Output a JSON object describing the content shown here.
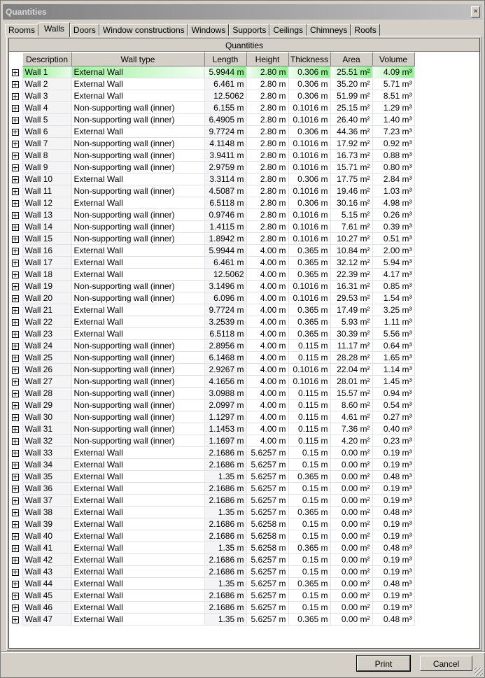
{
  "window": {
    "title": "Quantities",
    "close_label": "×"
  },
  "tabs": [
    {
      "label": "Rooms",
      "active": false
    },
    {
      "label": "Walls",
      "active": true
    },
    {
      "label": "Doors",
      "active": false
    },
    {
      "label": "Window constructions",
      "active": false
    },
    {
      "label": "Windows",
      "active": false
    },
    {
      "label": "Supports",
      "active": false
    },
    {
      "label": "Ceilings",
      "active": false
    },
    {
      "label": "Chimneys",
      "active": false
    },
    {
      "label": "Roofs",
      "active": false
    }
  ],
  "grid": {
    "group_header": "Quantities",
    "columns": [
      "Description",
      "Wall type",
      "Length",
      "Height",
      "Thickness",
      "Area",
      "Volume"
    ],
    "selected_row": 0,
    "rows": [
      [
        "Wall 1",
        "External Wall",
        "5.9944 m",
        "2.80 m",
        "0.306 m",
        "25.51 m²",
        "4.09 m³"
      ],
      [
        "Wall 2",
        "External Wall",
        "6.461 m",
        "2.80 m",
        "0.306 m",
        "35.20 m²",
        "5.71 m³"
      ],
      [
        "Wall 3",
        "External Wall",
        "12.5062",
        "2.80 m",
        "0.306 m",
        "51.99 m²",
        "8.51 m³"
      ],
      [
        "Wall 4",
        "Non-supporting wall (inner)",
        "6.155 m",
        "2.80 m",
        "0.1016 m",
        "25.15 m²",
        "1.29 m³"
      ],
      [
        "Wall 5",
        "Non-supporting wall (inner)",
        "6.4905 m",
        "2.80 m",
        "0.1016 m",
        "26.40 m²",
        "1.40 m³"
      ],
      [
        "Wall 6",
        "External Wall",
        "9.7724 m",
        "2.80 m",
        "0.306 m",
        "44.36 m²",
        "7.23 m³"
      ],
      [
        "Wall 7",
        "Non-supporting wall (inner)",
        "4.1148 m",
        "2.80 m",
        "0.1016 m",
        "17.92 m²",
        "0.92 m³"
      ],
      [
        "Wall 8",
        "Non-supporting wall (inner)",
        "3.9411 m",
        "2.80 m",
        "0.1016 m",
        "16.73 m²",
        "0.88 m³"
      ],
      [
        "Wall 9",
        "Non-supporting wall (inner)",
        "2.9759 m",
        "2.80 m",
        "0.1016 m",
        "15.71 m²",
        "0.80 m³"
      ],
      [
        "Wall 10",
        "External Wall",
        "3.3114 m",
        "2.80 m",
        "0.306 m",
        "17.75 m²",
        "2.84 m³"
      ],
      [
        "Wall 11",
        "Non-supporting wall (inner)",
        "4.5087 m",
        "2.80 m",
        "0.1016 m",
        "19.46 m²",
        "1.03 m³"
      ],
      [
        "Wall 12",
        "External Wall",
        "6.5118 m",
        "2.80 m",
        "0.306 m",
        "30.16 m²",
        "4.98 m³"
      ],
      [
        "Wall 13",
        "Non-supporting wall (inner)",
        "0.9746 m",
        "2.80 m",
        "0.1016 m",
        "5.15 m²",
        "0.26 m³"
      ],
      [
        "Wall 14",
        "Non-supporting wall (inner)",
        "1.4115 m",
        "2.80 m",
        "0.1016 m",
        "7.61 m²",
        "0.39 m³"
      ],
      [
        "Wall 15",
        "Non-supporting wall (inner)",
        "1.8942 m",
        "2.80 m",
        "0.1016 m",
        "10.27 m²",
        "0.51 m³"
      ],
      [
        "Wall 16",
        "External Wall",
        "5.9944 m",
        "4.00 m",
        "0.365 m",
        "10.84 m²",
        "2.00 m³"
      ],
      [
        "Wall 17",
        "External Wall",
        "6.461 m",
        "4.00 m",
        "0.365 m",
        "32.12 m²",
        "5.94 m³"
      ],
      [
        "Wall 18",
        "External Wall",
        "12.5062",
        "4.00 m",
        "0.365 m",
        "22.39 m²",
        "4.17 m³"
      ],
      [
        "Wall 19",
        "Non-supporting wall (inner)",
        "3.1496 m",
        "4.00 m",
        "0.1016 m",
        "16.31 m²",
        "0.85 m³"
      ],
      [
        "Wall 20",
        "Non-supporting wall (inner)",
        "6.096 m",
        "4.00 m",
        "0.1016 m",
        "29.53 m²",
        "1.54 m³"
      ],
      [
        "Wall 21",
        "External Wall",
        "9.7724 m",
        "4.00 m",
        "0.365 m",
        "17.49 m²",
        "3.25 m³"
      ],
      [
        "Wall 22",
        "External Wall",
        "3.2539 m",
        "4.00 m",
        "0.365 m",
        "5.93 m²",
        "1.11 m³"
      ],
      [
        "Wall 23",
        "External Wall",
        "6.5118 m",
        "4.00 m",
        "0.365 m",
        "30.39 m²",
        "5.56 m³"
      ],
      [
        "Wall 24",
        "Non-supporting wall (inner)",
        "2.8956 m",
        "4.00 m",
        "0.115 m",
        "11.17 m²",
        "0.64 m³"
      ],
      [
        "Wall 25",
        "Non-supporting wall (inner)",
        "6.1468 m",
        "4.00 m",
        "0.115 m",
        "28.28 m²",
        "1.65 m³"
      ],
      [
        "Wall 26",
        "Non-supporting wall (inner)",
        "2.9267 m",
        "4.00 m",
        "0.1016 m",
        "22.04 m²",
        "1.14 m³"
      ],
      [
        "Wall 27",
        "Non-supporting wall (inner)",
        "4.1656 m",
        "4.00 m",
        "0.1016 m",
        "28.01 m²",
        "1.45 m³"
      ],
      [
        "Wall 28",
        "Non-supporting wall (inner)",
        "3.0988 m",
        "4.00 m",
        "0.115 m",
        "15.57 m²",
        "0.94 m³"
      ],
      [
        "Wall 29",
        "Non-supporting wall (inner)",
        "2.0997 m",
        "4.00 m",
        "0.115 m",
        "8.60 m²",
        "0.54 m³"
      ],
      [
        "Wall 30",
        "Non-supporting wall (inner)",
        "1.1297 m",
        "4.00 m",
        "0.115 m",
        "4.61 m²",
        "0.27 m³"
      ],
      [
        "Wall 31",
        "Non-supporting wall (inner)",
        "1.1453 m",
        "4.00 m",
        "0.115 m",
        "7.36 m²",
        "0.40 m³"
      ],
      [
        "Wall 32",
        "Non-supporting wall (inner)",
        "1.1697 m",
        "4.00 m",
        "0.115 m",
        "4.20 m²",
        "0.23 m³"
      ],
      [
        "Wall 33",
        "External Wall",
        "2.1686 m",
        "5.6257 m",
        "0.15 m",
        "0.00 m²",
        "0.19 m³"
      ],
      [
        "Wall 34",
        "External Wall",
        "2.1686 m",
        "5.6257 m",
        "0.15 m",
        "0.00 m²",
        "0.19 m³"
      ],
      [
        "Wall 35",
        "External Wall",
        "1.35 m",
        "5.6257 m",
        "0.365 m",
        "0.00 m²",
        "0.48 m³"
      ],
      [
        "Wall 36",
        "External Wall",
        "2.1686 m",
        "5.6257 m",
        "0.15 m",
        "0.00 m²",
        "0.19 m³"
      ],
      [
        "Wall 37",
        "External Wall",
        "2.1686 m",
        "5.6257 m",
        "0.15 m",
        "0.00 m²",
        "0.19 m³"
      ],
      [
        "Wall 38",
        "External Wall",
        "1.35 m",
        "5.6257 m",
        "0.365 m",
        "0.00 m²",
        "0.48 m³"
      ],
      [
        "Wall 39",
        "External Wall",
        "2.1686 m",
        "5.6258 m",
        "0.15 m",
        "0.00 m²",
        "0.19 m³"
      ],
      [
        "Wall 40",
        "External Wall",
        "2.1686 m",
        "5.6258 m",
        "0.15 m",
        "0.00 m²",
        "0.19 m³"
      ],
      [
        "Wall 41",
        "External Wall",
        "1.35 m",
        "5.6258 m",
        "0.365 m",
        "0.00 m²",
        "0.48 m³"
      ],
      [
        "Wall 42",
        "External Wall",
        "2.1686 m",
        "5.6257 m",
        "0.15 m",
        "0.00 m²",
        "0.19 m³"
      ],
      [
        "Wall 43",
        "External Wall",
        "2.1686 m",
        "5.6257 m",
        "0.15 m",
        "0.00 m²",
        "0.19 m³"
      ],
      [
        "Wall 44",
        "External Wall",
        "1.35 m",
        "5.6257 m",
        "0.365 m",
        "0.00 m²",
        "0.48 m³"
      ],
      [
        "Wall 45",
        "External Wall",
        "2.1686 m",
        "5.6257 m",
        "0.15 m",
        "0.00 m²",
        "0.19 m³"
      ],
      [
        "Wall 46",
        "External Wall",
        "2.1686 m",
        "5.6257 m",
        "0.15 m",
        "0.00 m²",
        "0.19 m³"
      ],
      [
        "Wall 47",
        "External Wall",
        "1.35 m",
        "5.6257 m",
        "0.365 m",
        "0.00 m²",
        "0.48 m³"
      ]
    ]
  },
  "buttons": {
    "print": "Print",
    "cancel": "Cancel"
  }
}
